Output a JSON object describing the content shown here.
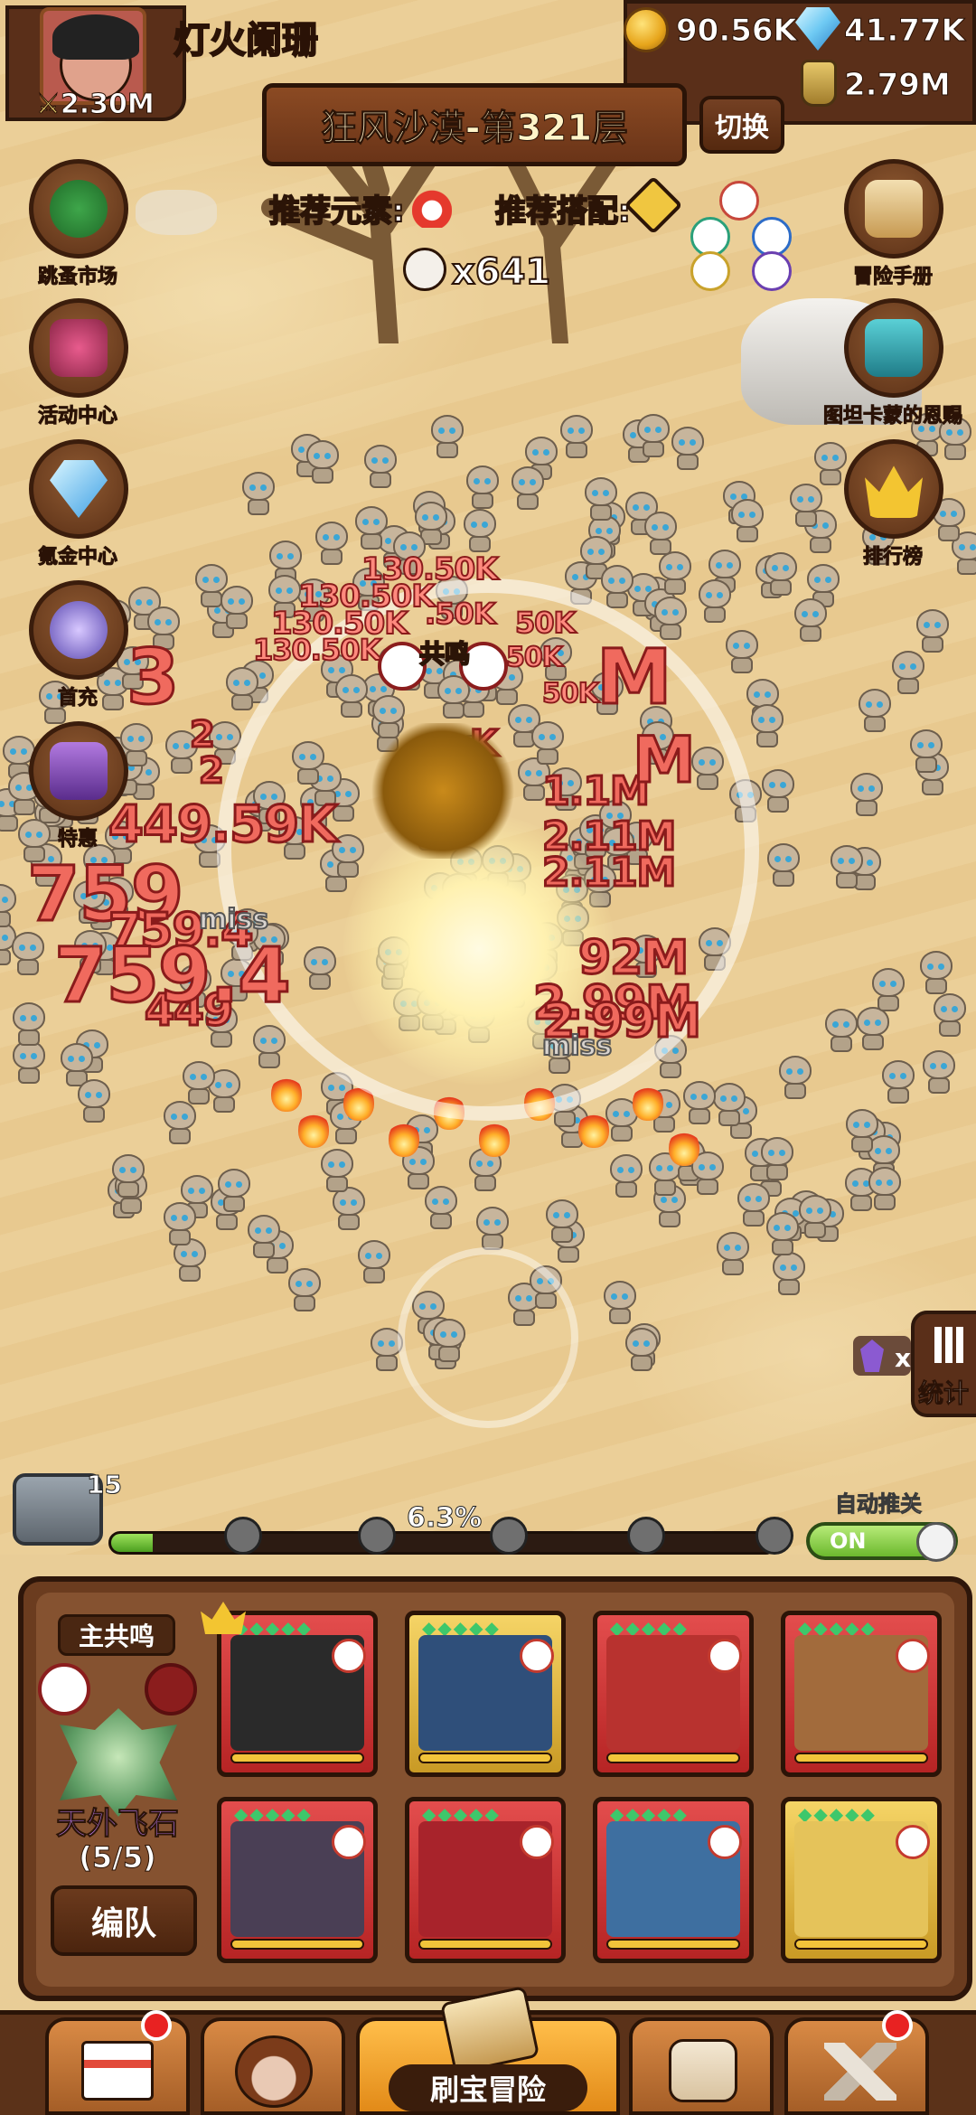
{
  "header": {
    "player_name": "灯火阑珊",
    "power": "2.30M",
    "gold": "90.56K",
    "diamonds": "41.77K",
    "potion": "2.79M"
  },
  "stage": {
    "title": "狂风沙漠-第321层",
    "switch_label": "切换",
    "recommend_element_label": "推荐元素:",
    "recommend_combo_label": "推荐搭配:",
    "kill_count": "x641"
  },
  "left_menu": [
    {
      "label": "跳蚤市场",
      "icon": "clover-icon"
    },
    {
      "label": "活动中心",
      "icon": "flower-bouquet-icon"
    },
    {
      "label": "氪金中心",
      "icon": "diamond-icon"
    },
    {
      "label": "首充",
      "icon": "scroll-icon"
    },
    {
      "label": "特惠",
      "icon": "treasure-box-icon"
    }
  ],
  "right_menu": [
    {
      "label": "冒险手册",
      "icon": "scroll-icon"
    },
    {
      "label": "图坦卡蒙的恩赐",
      "icon": "treasure-chest-icon"
    },
    {
      "label": "排行榜",
      "icon": "crown-icon"
    }
  ],
  "battle": {
    "damage_numbers": [
      "130.50K",
      "130.50K",
      "130.50K",
      "130.50K",
      ".50K",
      "50K",
      "50K",
      "50K",
      "3",
      "2",
      "2",
      "1.1M",
      "2.11M",
      "2.11M",
      "M",
      "M",
      "449.59K",
      "759",
      "759.4",
      "449",
      "759.4",
      "92M",
      "2.99M",
      "2.99M",
      "K"
    ],
    "miss_texts": [
      "miss",
      "miss"
    ],
    "boss_label": "共鸣"
  },
  "progress": {
    "chest_count": "15",
    "percent_text": "6.3%",
    "percent_value": 0.063,
    "auto_push_label": "自动推关",
    "auto_push_state": "ON",
    "stats_label": "统计",
    "crystal_prefix": "x"
  },
  "team": {
    "leader_tag": "主共鸣",
    "artifact_name": "天外飞石",
    "artifact_count": "(5/5)",
    "formation_button": "编队",
    "heroes": [
      {
        "name": "hero-1",
        "frame": "red"
      },
      {
        "name": "hero-2",
        "frame": "gold"
      },
      {
        "name": "hero-3",
        "frame": "red"
      },
      {
        "name": "hero-4",
        "frame": "red"
      },
      {
        "name": "hero-5",
        "frame": "red"
      },
      {
        "name": "hero-6",
        "frame": "red"
      },
      {
        "name": "hero-7",
        "frame": "red"
      },
      {
        "name": "hero-8",
        "frame": "gold"
      }
    ]
  },
  "nav": {
    "items": [
      "shop-icon",
      "hero-icon",
      "adventure-icon",
      "bag-icon",
      "forge-icon"
    ],
    "active_label": "刷宝冒险"
  }
}
